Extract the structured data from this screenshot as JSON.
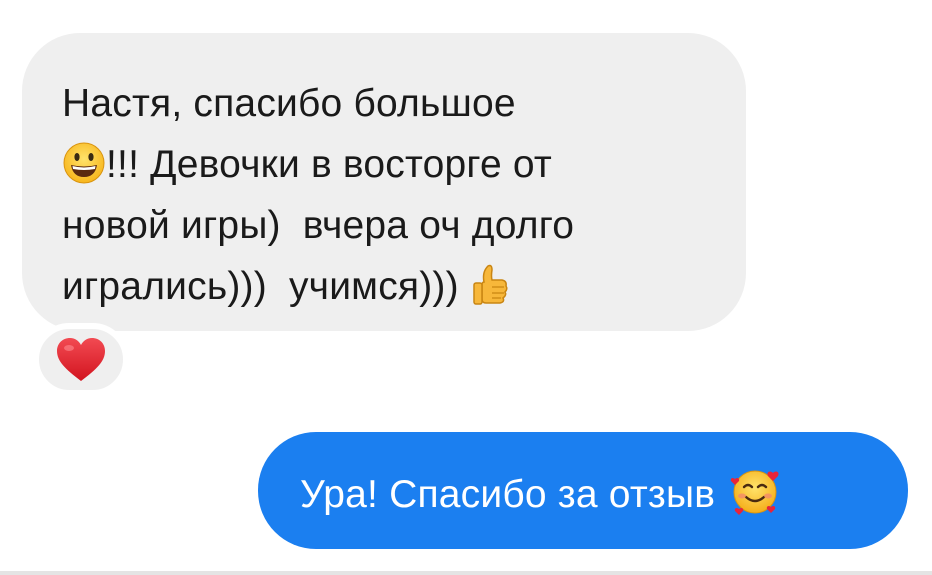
{
  "messages": {
    "incoming": {
      "line1": "Настя, спасибо большое",
      "line2_after_emoji": "!!! Девочки в восторге от",
      "line3": "новой игры)  вчера оч долго",
      "line4": "игрались)))  учимся))) ",
      "emoji_1": "grinning-face-icon",
      "emoji_2": "thumbs-up-icon",
      "reaction": "red-heart-icon"
    },
    "outgoing": {
      "text": "Ура! Спасибо за отзыв",
      "emoji": "smiling-face-with-hearts-icon"
    }
  },
  "colors": {
    "incoming_bubble": "#efefef",
    "outgoing_bubble": "#1b7ff0",
    "incoming_text": "#1a1a1a",
    "outgoing_text": "#ffffff",
    "heart": "#e4202e"
  }
}
